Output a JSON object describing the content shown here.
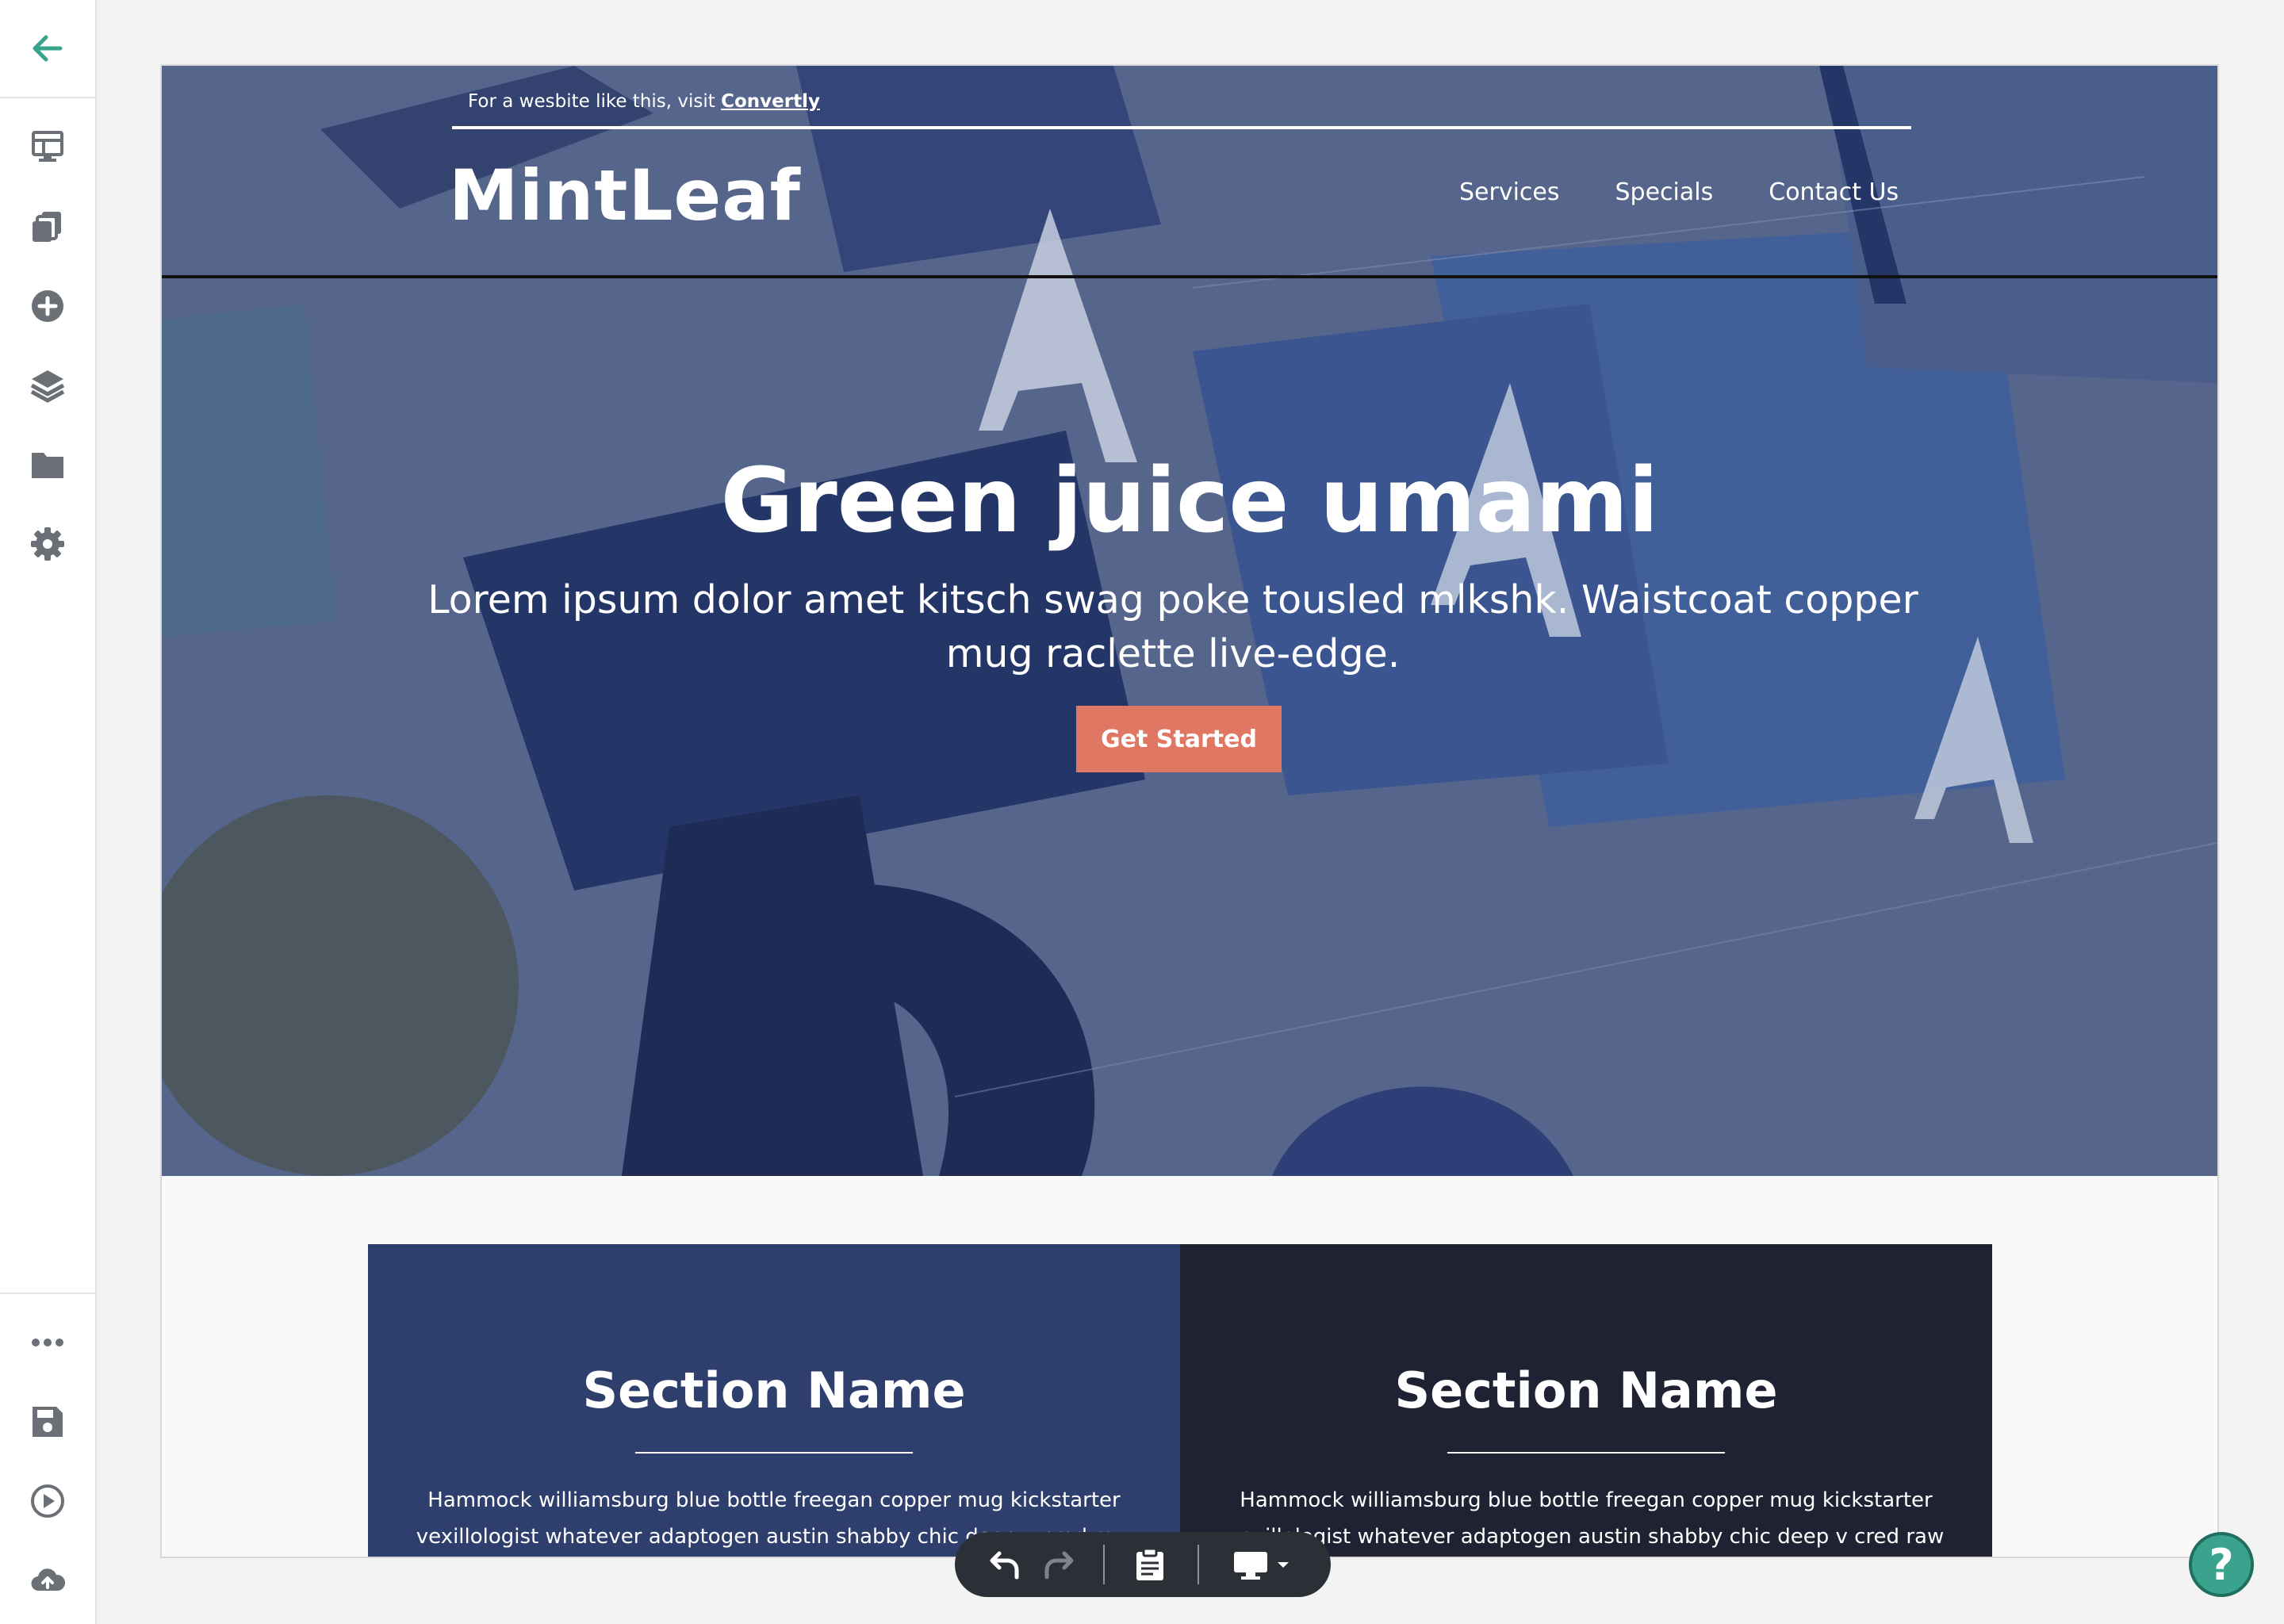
{
  "sidebar": {
    "items": [
      {
        "name": "back-arrow-icon"
      },
      {
        "name": "pages-icon"
      },
      {
        "name": "duplicate-icon"
      },
      {
        "name": "add-element-icon"
      },
      {
        "name": "layers-icon"
      },
      {
        "name": "folder-icon"
      },
      {
        "name": "settings-gear-icon"
      },
      {
        "name": "more-options-icon"
      },
      {
        "name": "save-icon"
      },
      {
        "name": "preview-play-icon"
      },
      {
        "name": "publish-cloud-icon"
      }
    ],
    "accent_color": "#3aa38e",
    "icon_color": "#6b6f76"
  },
  "site": {
    "topbar": {
      "prefix": "For a wesbite like this, visit ",
      "link": "Convertly"
    },
    "logo": "MintLeaf",
    "nav": [
      "Services",
      "Specials",
      "Contact Us"
    ],
    "hero": {
      "title": "Green juice umami",
      "subtitle": "Lorem ipsum dolor amet kitsch swag poke tousled mlkshk. Waistcoat copper mug raclette live-edge.",
      "button": "Get Started",
      "button_color": "#e07763",
      "overlay_color": "#55648a"
    },
    "sections": [
      {
        "title": "Section Name",
        "text": "Hammock williamsburg blue bottle freegan copper mug kickstarter vexillologist whatever adaptogen austin shabby chic deep v cred raw",
        "color": "#2f3f6d"
      },
      {
        "title": "Section Name",
        "text": "Hammock williamsburg blue bottle freegan copper mug kickstarter vexillologist whatever adaptogen austin shabby chic deep v cred raw",
        "color": "#1e2233"
      }
    ]
  },
  "toolbar": {
    "items": [
      "undo-icon",
      "redo-icon",
      "clipboard-icon",
      "desktop-view-icon",
      "caret-down-icon"
    ]
  },
  "help": {
    "label": "?"
  }
}
